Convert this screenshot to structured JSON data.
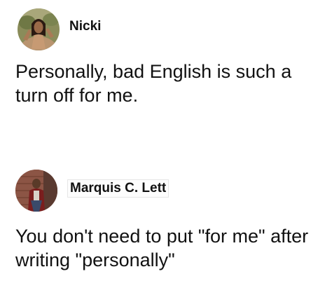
{
  "post1": {
    "username": "Nicki",
    "text": "Personally, bad English is such a turn off for me.",
    "avatar_icon": "user-photo-icon"
  },
  "post2": {
    "username": "Marquis C. Lett",
    "text": "You don't need to put \"for me\" after writing \"personally\"",
    "avatar_icon": "user-photo-icon"
  }
}
